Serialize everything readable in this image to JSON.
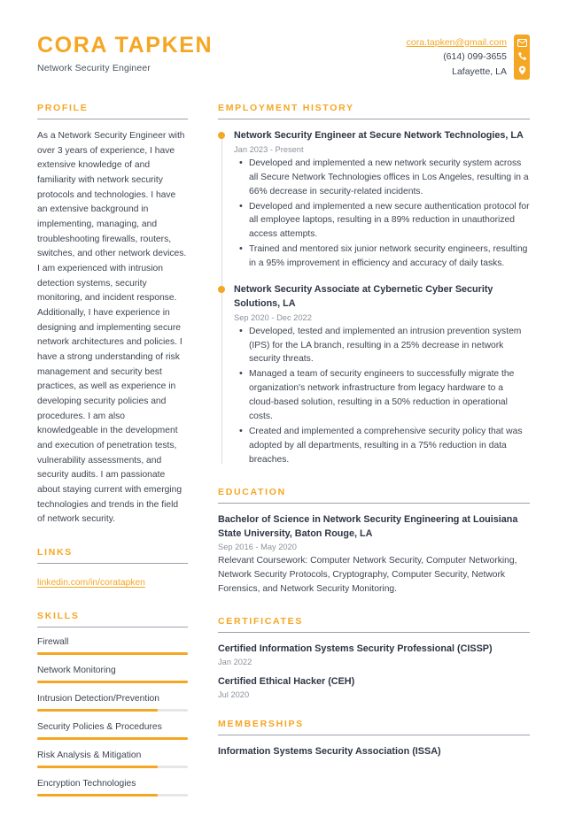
{
  "theme": {
    "accent": "#f5a623",
    "text": "#3d4451",
    "heading": "#2d3544",
    "muted": "#8b919c",
    "rule": "#9aa0ab",
    "track": "#e6e6e6",
    "timeline_line": "#dcdde1",
    "background": "#ffffff"
  },
  "header": {
    "name": "CORA TAPKEN",
    "job_title": "Network Security Engineer",
    "contact": {
      "email": "cora.tapken@gmail.com",
      "phone": "(614) 099-3655",
      "location": "Lafayette, LA",
      "icons": [
        "envelope-icon",
        "phone-icon",
        "location-pin-icon"
      ]
    }
  },
  "left": {
    "profile": {
      "heading": "PROFILE",
      "text": "As a Network Security Engineer with over 3 years of experience, I have extensive knowledge of and familiarity with network security protocols and technologies. I have an extensive background in implementing, managing, and troubleshooting firewalls, routers, switches, and other network devices. I am experienced with intrusion detection systems, security monitoring, and incident response. Additionally, I have experience in designing and implementing secure network architectures and policies. I have a strong understanding of risk management and security best practices, as well as experience in developing security policies and procedures. I am also knowledgeable in the development and execution of penetration tests, vulnerability assessments, and security audits. I am passionate about staying current with emerging technologies and trends in the field of network security."
    },
    "links": {
      "heading": "LINKS",
      "items": [
        {
          "label": "linkedin.com/in/coratapken"
        }
      ]
    },
    "skills": {
      "heading": "SKILLS",
      "items": [
        {
          "name": "Firewall",
          "level": 100
        },
        {
          "name": "Network Monitoring",
          "level": 100
        },
        {
          "name": "Intrusion Detection/Prevention",
          "level": 80
        },
        {
          "name": "Security Policies & Procedures",
          "level": 100
        },
        {
          "name": "Risk Analysis & Mitigation",
          "level": 80
        },
        {
          "name": "Encryption Technologies",
          "level": 80
        }
      ]
    }
  },
  "right": {
    "employment": {
      "heading": "EMPLOYMENT HISTORY",
      "entries": [
        {
          "title": "Network Security Engineer at Secure Network Technologies, LA",
          "date": "Jan 2023 - Present",
          "bullets": [
            "Developed and implemented a new network security system across all Secure Network Technologies offices in Los Angeles, resulting in a 66% decrease in security-related incidents.",
            "Developed and implemented a new secure authentication protocol for all employee laptops, resulting in a 89% reduction in unauthorized access attempts.",
            "Trained and mentored six junior network security engineers, resulting in a 95% improvement in efficiency and accuracy of daily tasks."
          ]
        },
        {
          "title": "Network Security Associate at Cybernetic Cyber Security Solutions, LA",
          "date": "Sep 2020 - Dec 2022",
          "bullets": [
            "Developed, tested and implemented an intrusion prevention system (IPS) for the LA branch, resulting in a 25% decrease in network security threats.",
            "Managed a team of security engineers to successfully migrate the organization's network infrastructure from legacy hardware to a cloud-based solution, resulting in a 50% reduction in operational costs.",
            "Created and implemented a comprehensive security policy that was adopted by all departments, resulting in a 75% reduction in data breaches."
          ]
        }
      ]
    },
    "education": {
      "heading": "EDUCATION",
      "entries": [
        {
          "title": "Bachelor of Science in Network Security Engineering at Louisiana State University, Baton Rouge, LA",
          "date": "Sep 2016 - May 2020",
          "description": "Relevant Coursework: Computer Network Security, Computer Networking, Network Security Protocols, Cryptography, Computer Security, Network Forensics, and Network Security Monitoring."
        }
      ]
    },
    "certificates": {
      "heading": "CERTIFICATES",
      "entries": [
        {
          "title": "Certified Information Systems Security Professional (CISSP)",
          "date": "Jan 2022"
        },
        {
          "title": "Certified Ethical Hacker (CEH)",
          "date": "Jul 2020"
        }
      ]
    },
    "memberships": {
      "heading": "MEMBERSHIPS",
      "entries": [
        {
          "title": "Information Systems Security Association (ISSA)"
        }
      ]
    }
  }
}
